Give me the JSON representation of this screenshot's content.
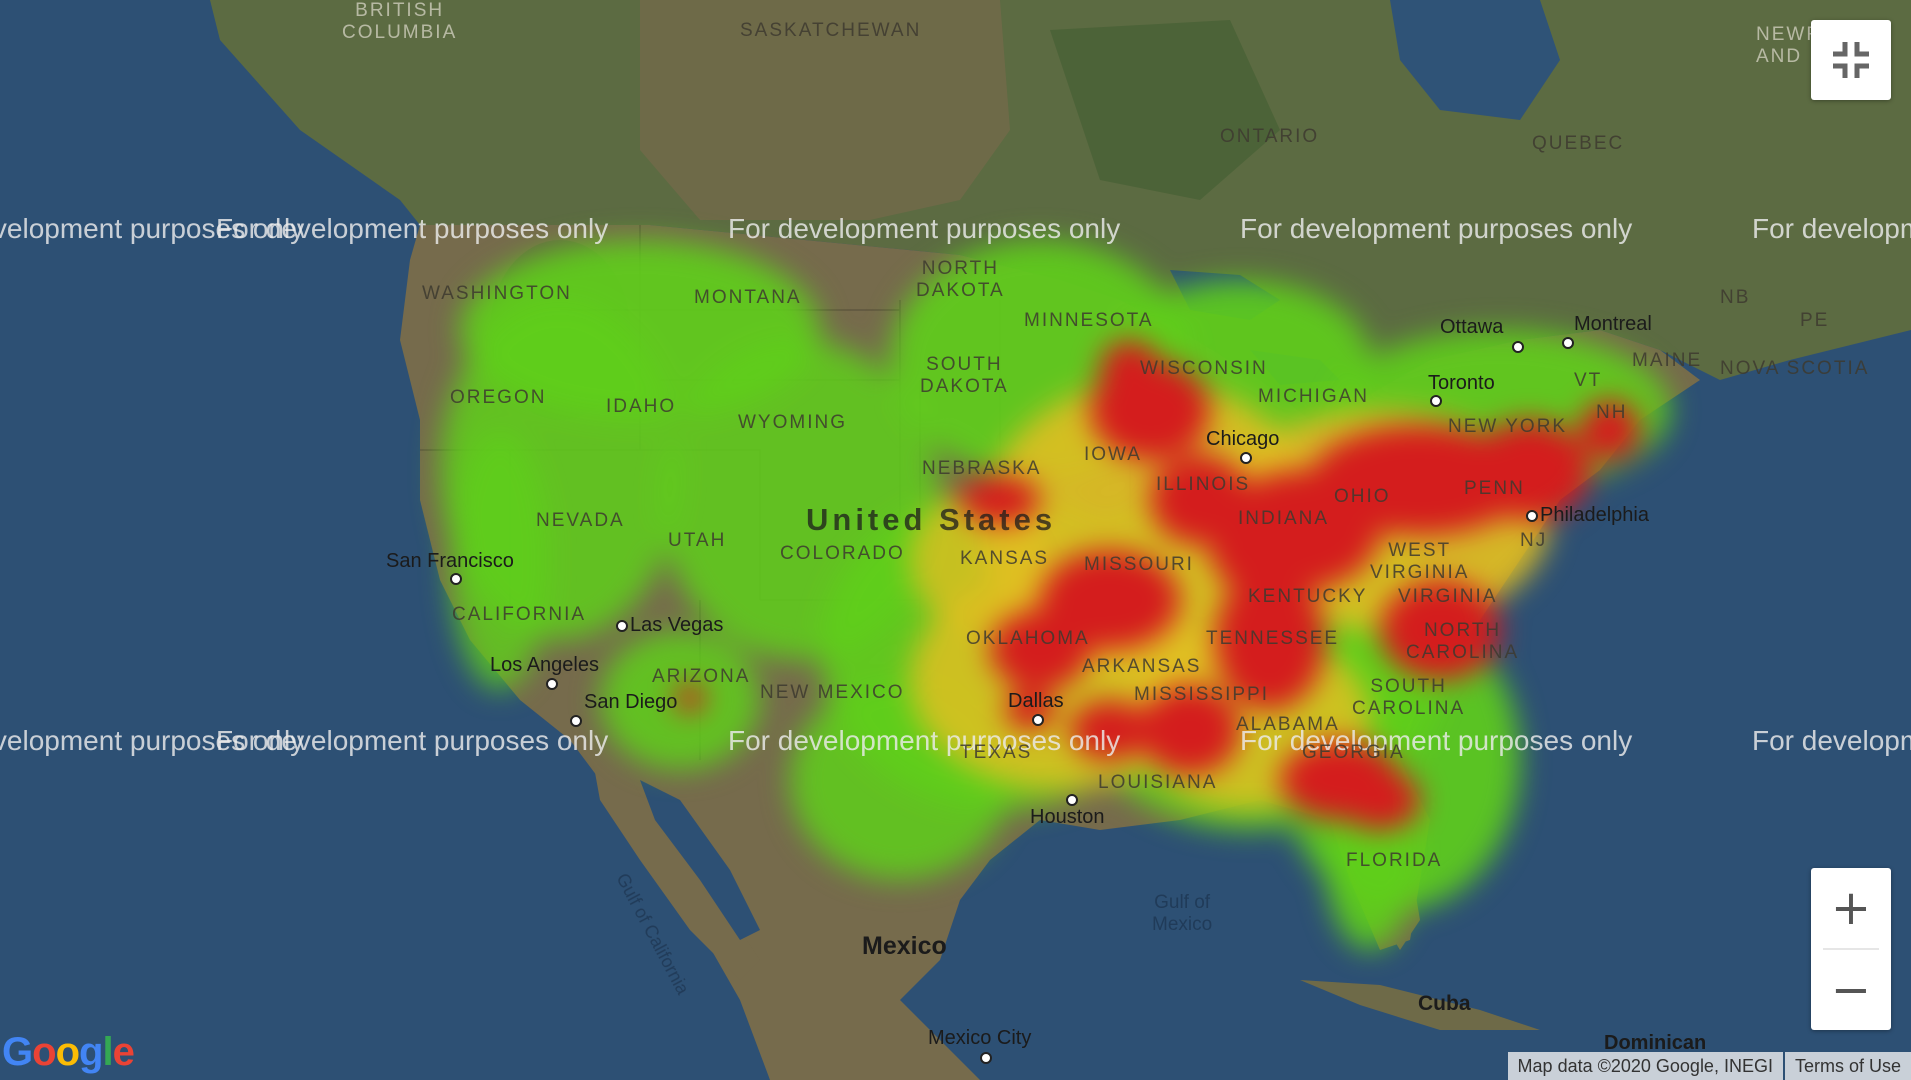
{
  "map": {
    "watermark": "For development purposes only",
    "country_label": "United States",
    "regions": {
      "british_columbia": "BRITISH\nCOLUMBIA",
      "saskatchewan": "SASKATCHEWAN",
      "ontario": "ONTARIO",
      "quebec": "QUEBEC",
      "newfoundland": "NEWF\nAND",
      "washington": "WASHINGTON",
      "montana": "MONTANA",
      "north_dakota": "NORTH\nDAKOTA",
      "minnesota": "MINNESOTA",
      "oregon": "OREGON",
      "idaho": "IDAHO",
      "wyoming": "WYOMING",
      "south_dakota": "SOUTH\nDAKOTA",
      "wisconsin": "WISCONSIN",
      "michigan": "MICHIGAN",
      "nebraska": "NEBRASKA",
      "iowa": "IOWA",
      "illinois": "ILLINOIS",
      "nevada": "NEVADA",
      "utah": "UTAH",
      "colorado": "COLORADO",
      "kansas": "KANSAS",
      "missouri": "MISSOURI",
      "indiana": "INDIANA",
      "ohio": "OHIO",
      "penn": "PENN",
      "new_york": "NEW YORK",
      "west_virginia": "WEST\nVIRGINIA",
      "kentucky": "KENTUCKY",
      "virginia": "VIRGINIA",
      "california": "CALIFORNIA",
      "arizona": "ARIZONA",
      "new_mexico": "NEW MEXICO",
      "oklahoma": "OKLAHOMA",
      "arkansas": "ARKANSAS",
      "tennessee": "TENNESSEE",
      "north_carolina": "NORTH\nCAROLINA",
      "south_carolina": "SOUTH\nCAROLINA",
      "mississippi": "MISSISSIPPI",
      "alabama": "ALABAMA",
      "georgia": "GEORGIA",
      "texas": "TEXAS",
      "louisiana": "LOUISIANA",
      "florida": "FLORIDA",
      "maine": "MAINE",
      "nb": "NB",
      "pe": "PE",
      "nova_scotia": "NOVA SCOTIA",
      "vt": "VT",
      "nh": "NH",
      "nj": "NJ"
    },
    "cities": {
      "ottawa": "Ottawa",
      "montreal": "Montreal",
      "toronto": "Toronto",
      "chicago": "Chicago",
      "philadelphia": "Philadelphia",
      "san_francisco": "San Francisco",
      "las_vegas": "Las Vegas",
      "los_angeles": "Los Angeles",
      "san_diego": "San Diego",
      "dallas": "Dallas",
      "houston": "Houston",
      "mexico": "Mexico",
      "mexico_city": "Mexico City",
      "cuba": "Cuba",
      "dominican": "Dominican"
    },
    "water": {
      "gulf_of_mexico": "Gulf of\nMexico",
      "gulf_of_california": "Gulf of California"
    },
    "heatmap_colors": {
      "low": "#66d51a",
      "mid": "#e0c020",
      "high": "#d41d1d"
    },
    "colors": {
      "ocean": "#2d5074",
      "land": "#756a4c",
      "forest": "#4e6a3c"
    }
  },
  "controls": {
    "fullscreen_icon": "exit-fullscreen-icon",
    "zoom_in_symbol": "+",
    "zoom_out_symbol": "−"
  },
  "footer": {
    "map_data": "Map data ©2020 Google, INEGI",
    "terms": "Terms of Use"
  },
  "google_logo": "Google"
}
